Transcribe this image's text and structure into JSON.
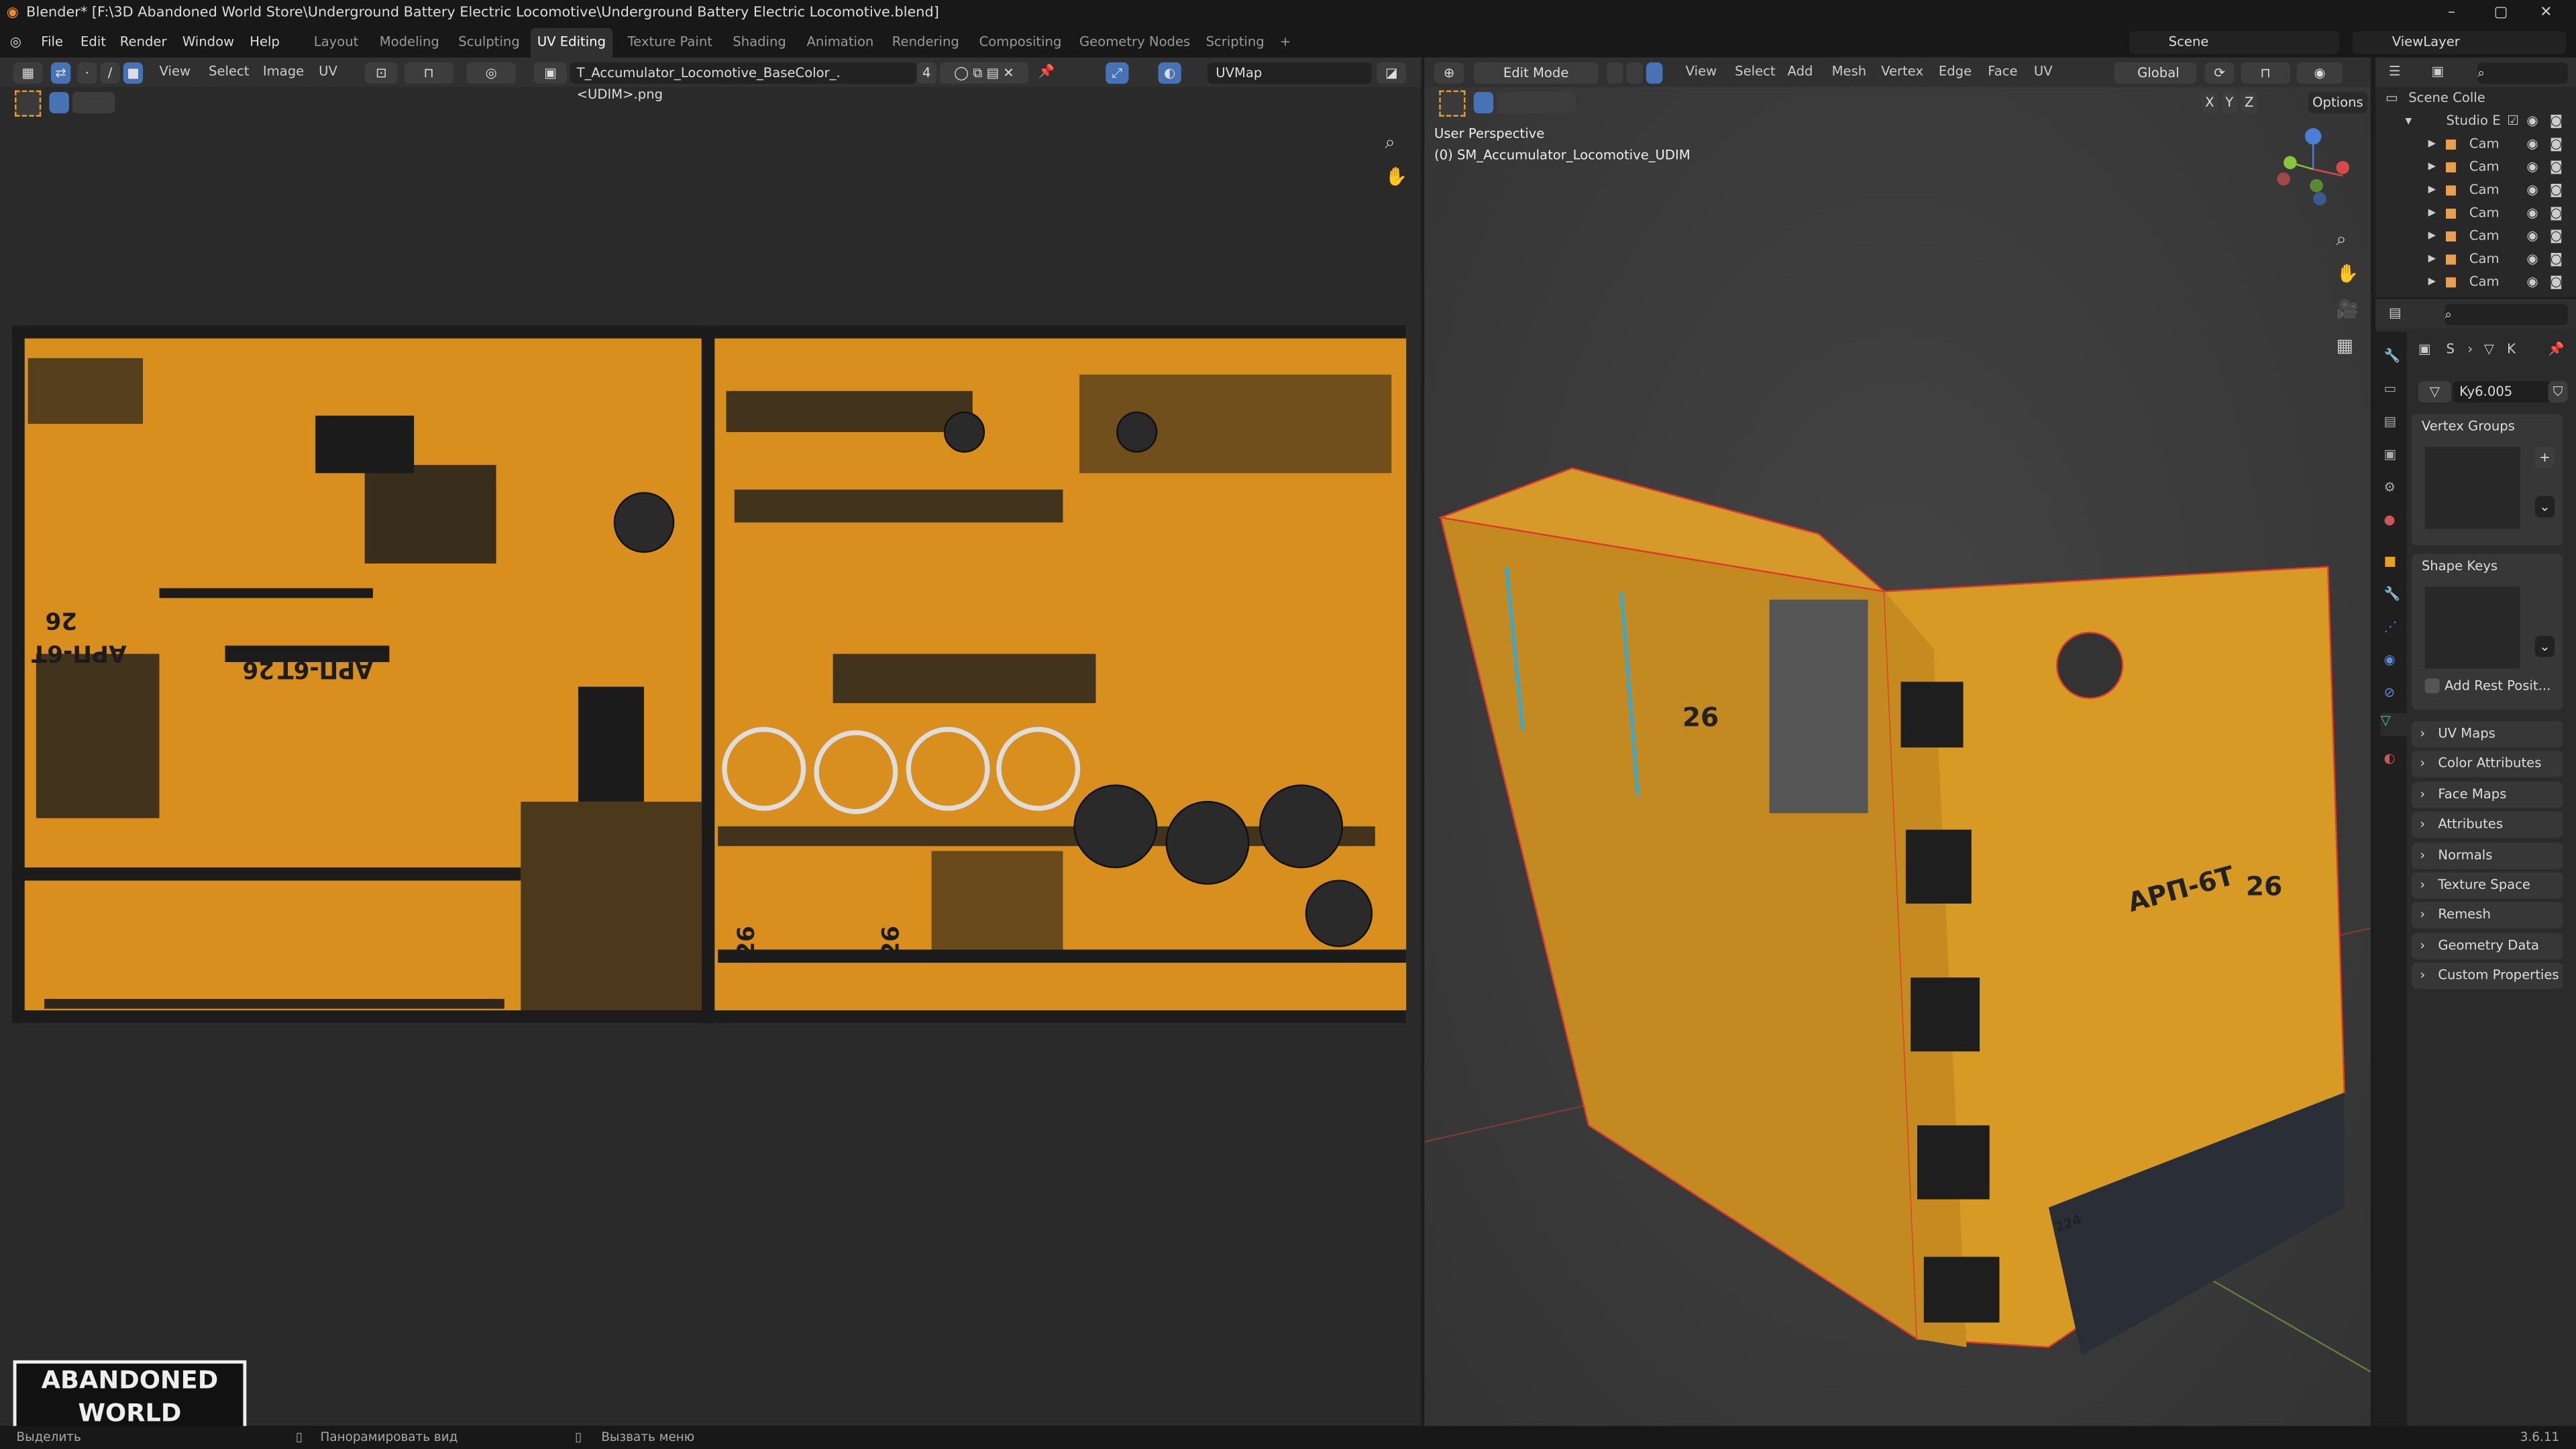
{
  "window": {
    "title": "Blender* [F:\\3D Abandoned World Store\\Underground Battery Electric Locomotive\\Underground Battery Electric Locomotive.blend]",
    "minimize": "–",
    "maximize": "▢",
    "close": "✕"
  },
  "menu": [
    "File",
    "Edit",
    "Render",
    "Window",
    "Help"
  ],
  "workspaces": [
    "Layout",
    "Modeling",
    "Sculpting",
    "UV Editing",
    "Texture Paint",
    "Shading",
    "Animation",
    "Rendering",
    "Compositing",
    "Geometry Nodes",
    "Scripting",
    "+"
  ],
  "active_workspace": "UV Editing",
  "scene": {
    "label": "Scene",
    "view_layer": "ViewLayer"
  },
  "uv_editor": {
    "menus": [
      "View",
      "Select",
      "Image",
      "UV"
    ],
    "image_name": "T_Accumulator_Locomotive_BaseColor_.<UDIM>.png",
    "users": "4",
    "uv_map": "UVMap",
    "texture_labels": [
      "АРП-6Т",
      "26",
      "АРП-6Т",
      "26",
      "26",
      "26"
    ]
  },
  "viewport": {
    "mode": "Edit Mode",
    "menus": [
      "View",
      "Select",
      "Add",
      "Mesh",
      "Vertex",
      "Edge",
      "Face",
      "UV"
    ],
    "orientation": "Global",
    "options": "Options",
    "axes": [
      "X",
      "Y",
      "Z"
    ],
    "overlay_line1": "User Perspective",
    "overlay_line2": "(0) SM_Accumulator_Locomotive_UDIM",
    "model_labels": [
      "26",
      "АРП-6Т",
      "26",
      "224"
    ]
  },
  "outliner": {
    "root": "Scene Colle",
    "collection": "Studio E",
    "items": [
      "Cam",
      "Cam",
      "Cam",
      "Cam",
      "Cam",
      "Cam",
      "Cam"
    ]
  },
  "properties": {
    "breadcrumb_obj": "S",
    "breadcrumb_mesh": "K",
    "mesh_name": "Ky6.005",
    "vertex_groups": "Vertex Groups",
    "shape_keys": "Shape Keys",
    "add_rest": "Add Rest Posit...",
    "panels": [
      "UV Maps",
      "Color Attributes",
      "Face Maps",
      "Attributes",
      "Normals",
      "Texture Space",
      "Remesh",
      "Geometry Data",
      "Custom Properties"
    ]
  },
  "status": {
    "left": "Выделить",
    "pan": "Панорамировать вид",
    "menu": "Вызвать меню",
    "version": "3.6.11"
  },
  "watermark": [
    "ABANDONED",
    "WORLD"
  ],
  "colors": {
    "accent": "#4772b3",
    "orange": "#e8a020",
    "edge": "#e03a2a"
  }
}
